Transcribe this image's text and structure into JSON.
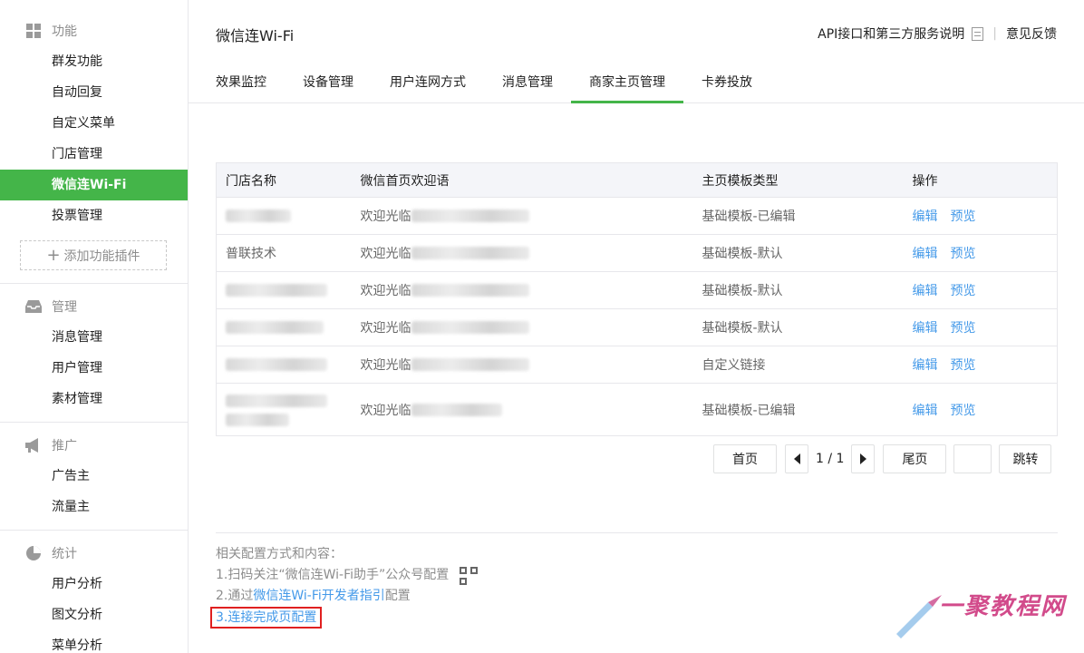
{
  "sidebar": {
    "sections": [
      {
        "head": "功能",
        "icon": "grid-icon",
        "items": [
          "群发功能",
          "自动回复",
          "自定义菜单",
          "门店管理",
          "微信连Wi-Fi",
          "投票管理"
        ],
        "add_label": "添加功能插件"
      },
      {
        "head": "管理",
        "icon": "inbox-icon",
        "items": [
          "消息管理",
          "用户管理",
          "素材管理"
        ]
      },
      {
        "head": "推广",
        "icon": "megaphone-icon",
        "items": [
          "广告主",
          "流量主"
        ]
      },
      {
        "head": "统计",
        "icon": "pie-chart-icon",
        "items": [
          "用户分析",
          "图文分析",
          "菜单分析"
        ]
      }
    ],
    "active_item": "微信连Wi-Fi",
    "accent_color": "#44b549"
  },
  "header": {
    "title": "微信连Wi-Fi",
    "api_link": "API接口和第三方服务说明",
    "separator": "|",
    "feedback_link": "意见反馈"
  },
  "tabs": [
    "效果监控",
    "设备管理",
    "用户连网方式",
    "消息管理",
    "商家主页管理",
    "卡券投放"
  ],
  "active_tab": "商家主页管理",
  "table": {
    "columns": [
      "门店名称",
      "微信首页欢迎语",
      "主页模板类型",
      "操作"
    ],
    "rows": [
      {
        "name": "",
        "welcome": "欢迎光临",
        "template": "基础模板-已编辑"
      },
      {
        "name": "普联技术",
        "welcome": "欢迎光临",
        "template": "基础模板-默认"
      },
      {
        "name": "",
        "welcome": "欢迎光临",
        "template": "基础模板-默认"
      },
      {
        "name": "",
        "welcome": "欢迎光临",
        "template": "基础模板-默认"
      },
      {
        "name": "",
        "welcome": "欢迎光临",
        "template": "自定义链接"
      },
      {
        "name": "",
        "welcome": "欢迎光临",
        "template": "基础模板-已编辑"
      }
    ],
    "action_edit": "编辑",
    "action_preview": "预览"
  },
  "pager": {
    "first": "首页",
    "page_text": "1 / 1",
    "last": "尾页",
    "jump_input": "",
    "jump": "跳转"
  },
  "notes": {
    "heading": "相关配置方式和内容：",
    "line1": "1.扫码关注“微信连Wi-Fi助手”公众号配置",
    "line2_prefix": "2.通过",
    "line2_link": "微信连Wi-Fi开发者指引",
    "line2_suffix": "配置",
    "line3": "3.连接完成页配置"
  },
  "watermark": {
    "text": "一聚教程网"
  }
}
